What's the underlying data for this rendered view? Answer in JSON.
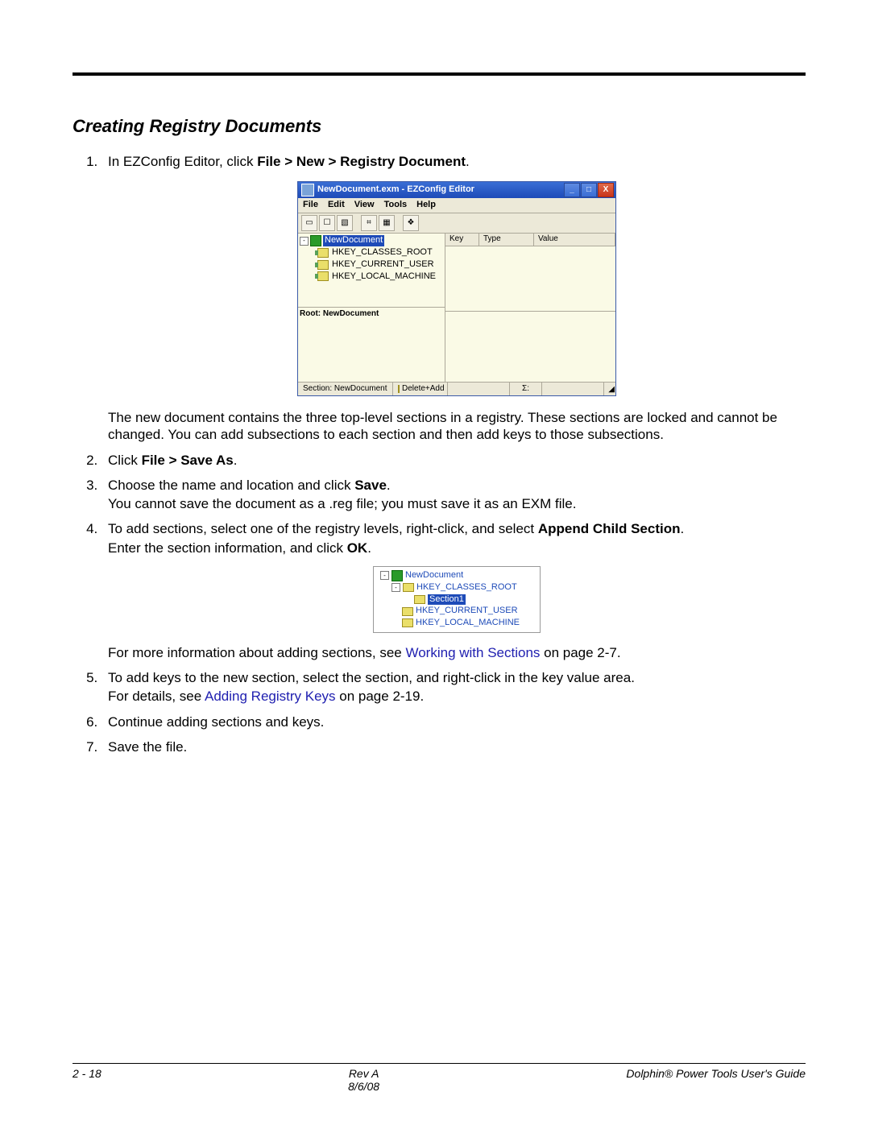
{
  "heading": "Creating Registry Documents",
  "steps": {
    "s1_prefix": "In EZConfig Editor, click ",
    "s1_bold": "File > New > Registry Document",
    "s1_suffix": ".",
    "after1": "The new document contains the three top-level sections in a registry. These sections are locked and cannot be changed. You can add subsections to each section and then add keys to those subsections.",
    "s2_prefix": "Click ",
    "s2_bold": "File > Save As",
    "s2_suffix": ".",
    "s3_line1_prefix": "Choose the name and location and click ",
    "s3_line1_bold": "Save",
    "s3_line1_suffix": ".",
    "s3_line2": "You cannot save the document as a .reg file; you must save it as an EXM file.",
    "s4_line1_prefix": "To add sections, select one of the registry levels, right-click, and select ",
    "s4_line1_bold": "Append Child Section",
    "s4_line1_suffix": ".",
    "s4_line2_prefix": "Enter the section information, and click ",
    "s4_line2_bold": "OK",
    "s4_line2_suffix": ".",
    "s4_after_prefix": "For more information about adding sections, see ",
    "s4_after_link": "Working with Sections",
    "s4_after_suffix": " on page 2-7.",
    "s5_line1": "To add keys to the new section, select the section, and right-click in the key value area.",
    "s5_line2_prefix": "For details, see ",
    "s5_line2_link": "Adding Registry Keys",
    "s5_line2_suffix": " on page 2-19.",
    "s6": "Continue adding sections and keys.",
    "s7": "Save the file."
  },
  "shot1": {
    "title": "NewDocument.exm - EZConfig Editor",
    "menu": {
      "file": "File",
      "edit": "Edit",
      "view": "View",
      "tools": "Tools",
      "help": "Help"
    },
    "tree": {
      "root": "NewDocument",
      "children": [
        "HKEY_CLASSES_ROOT",
        "HKEY_CURRENT_USER",
        "HKEY_LOCAL_MACHINE"
      ]
    },
    "detail_label": "Root: NewDocument",
    "cols": {
      "key": "Key",
      "type": "Type",
      "value": "Value"
    },
    "status": {
      "section": "Section: NewDocument",
      "mode": "Delete+Add",
      "sigma": "Σ:"
    }
  },
  "shot2": {
    "root": "NewDocument",
    "hkcr": "HKEY_CLASSES_ROOT",
    "section1": "Section1",
    "hkcu": "HKEY_CURRENT_USER",
    "hklm": "HKEY_LOCAL_MACHINE"
  },
  "footer": {
    "left": "2 - 18",
    "rev": "Rev A",
    "date": "8/6/08",
    "right": "Dolphin® Power Tools User's Guide"
  }
}
